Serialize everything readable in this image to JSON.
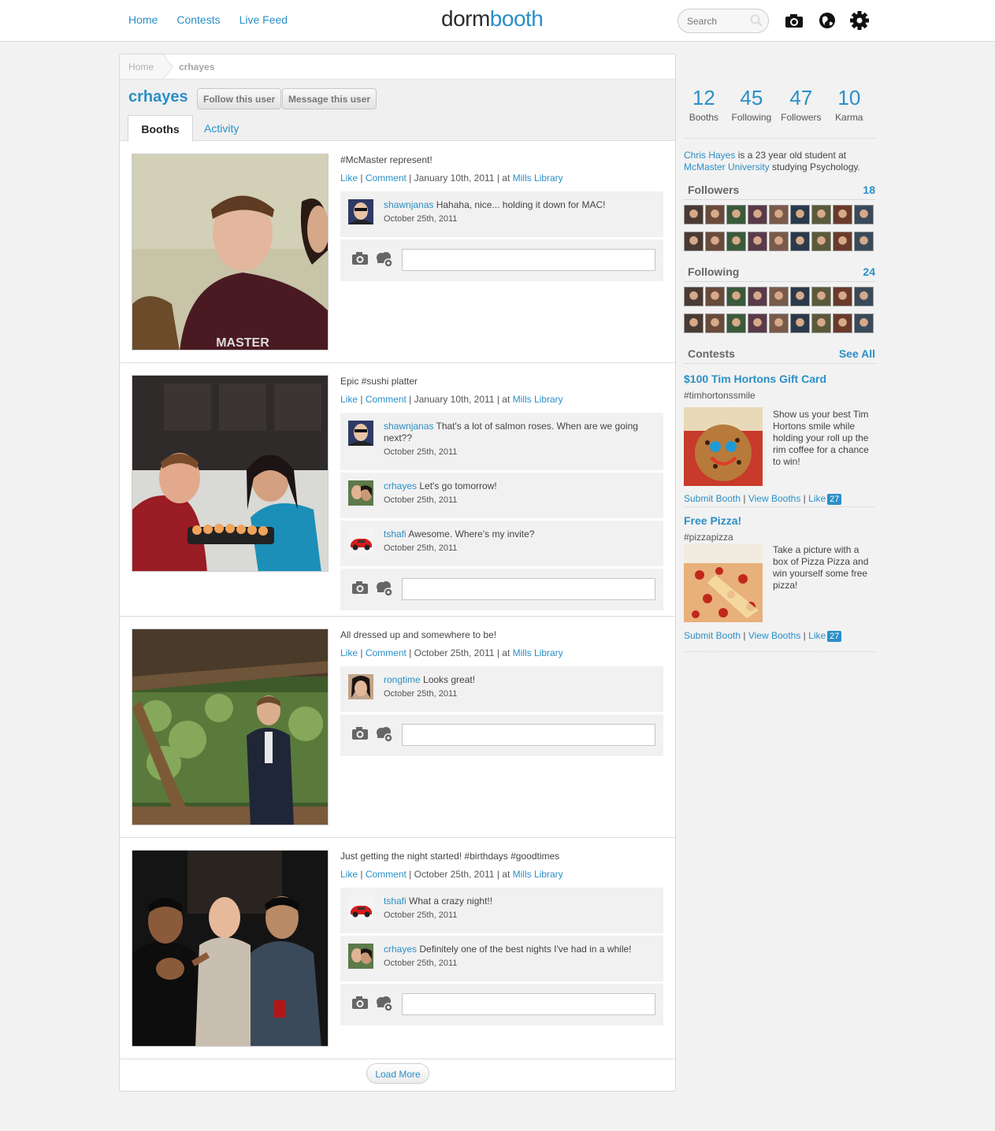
{
  "nav": {
    "home": "Home",
    "contests": "Contests",
    "live_feed": "Live Feed"
  },
  "logo": {
    "part1": "dorm",
    "part2": "booth"
  },
  "search": {
    "placeholder": "Search"
  },
  "breadcrumb": {
    "home": "Home",
    "current": "crhayes"
  },
  "profile": {
    "username": "crhayes",
    "follow_label": "Follow this user",
    "message_label": "Message this user",
    "tabs": [
      {
        "label": "Booths"
      },
      {
        "label": "Activity"
      }
    ]
  },
  "posts": [
    {
      "caption": "#McMaster represent!",
      "like": "Like",
      "comment": "Comment",
      "date": "January 10th, 2011",
      "at": "at",
      "location": "Mills Library",
      "comments": [
        {
          "user": "shawnjanas",
          "text": "Hahaha, nice... holding it down for MAC!",
          "date": "October 25th, 2011"
        }
      ]
    },
    {
      "caption": "Epic #sushi platter",
      "like": "Like",
      "comment": "Comment",
      "date": "January 10th, 2011",
      "at": "at",
      "location": "Mills Library",
      "comments": [
        {
          "user": "shawnjanas",
          "text": "That's a lot of salmon roses. When are we going next??",
          "date": "October 25th, 2011"
        },
        {
          "user": "crhayes",
          "text": "Let's go tomorrow!",
          "date": "October 25th, 2011"
        },
        {
          "user": "tshafi",
          "text": "Awesome. Where's my invite?",
          "date": "October 25th, 2011"
        }
      ]
    },
    {
      "caption": "All dressed up and somewhere to be!",
      "like": "Like",
      "comment": "Comment",
      "date": "October 25th, 2011",
      "at": "at",
      "location": "Mills Library",
      "comments": [
        {
          "user": "rongtime",
          "text": "Looks great!",
          "date": "October 25th, 2011"
        }
      ]
    },
    {
      "caption": "Just getting the night started! #birthdays #goodtimes",
      "like": "Like",
      "comment": "Comment",
      "date": "October 25th, 2011",
      "at": "at",
      "location": "Mills Library",
      "comments": [
        {
          "user": "tshafi",
          "text": "What a crazy night!!",
          "date": "October 25th, 2011"
        },
        {
          "user": "crhayes",
          "text": "Definitely one of the best nights I've had in a while!",
          "date": "October 25th, 2011"
        }
      ]
    }
  ],
  "load_more": "Load More",
  "stats": [
    {
      "value": "12",
      "label": "Booths"
    },
    {
      "value": "45",
      "label": "Following"
    },
    {
      "value": "47",
      "label": "Followers"
    },
    {
      "value": "10",
      "label": "Karma"
    }
  ],
  "bio": {
    "name": "Chris Hayes",
    "pre": "is a 23 year old student at",
    "school": "McMaster University",
    "post": "studying Psychology."
  },
  "followers": {
    "title": "Followers",
    "count": "18"
  },
  "following": {
    "title": "Following",
    "count": "24"
  },
  "contests": {
    "title": "Contests",
    "see_all": "See All",
    "items": [
      {
        "title": "$100 Tim Hortons Gift Card",
        "tag": "#timhortonssmile",
        "desc": "Show us your best Tim Hortons smile while holding your roll up the rim coffee for a chance to win!",
        "submit": "Submit Booth",
        "view": "View Booths",
        "like": "Like",
        "likes": "27"
      },
      {
        "title": "Free Pizza!",
        "tag": "#pizzapizza",
        "desc": "Take a picture with a box of Pizza Pizza and win yourself some free pizza!",
        "submit": "Submit Booth",
        "view": "View Booths",
        "like": "Like",
        "likes": "27"
      }
    ]
  },
  "colors": {
    "accent": "#2a8fc7",
    "panel": "#f1f1f1",
    "page_bg": "#f2f2f2"
  }
}
